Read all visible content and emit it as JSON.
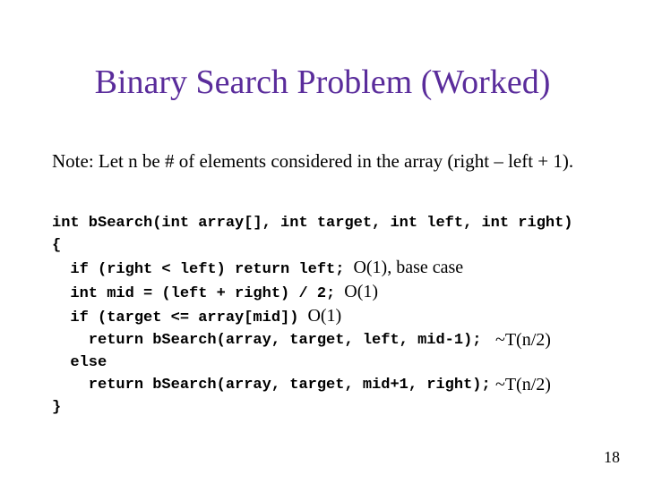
{
  "title": "Binary Search Problem (Worked)",
  "note": "Note: Let n be # of elements considered in the array (right – left + 1).",
  "code": {
    "l1": "int bSearch(int array[], int target, int left, int right)",
    "l2": "{",
    "l3": "  if (right < left) return left;",
    "l3a": "  O(1), base case",
    "l4": "  int mid = (left + right) / 2;",
    "l4a": "  O(1)",
    "l5": "  if (target <= array[mid])",
    "l5a": "  O(1)",
    "l6": "    return bSearch(array, target, left, mid-1);",
    "l6a": "~T(n/2)",
    "l7": "  else",
    "l8": "    return bSearch(array, target, mid+1, right);",
    "l8a": "~T(n/2)",
    "l9": "}"
  },
  "page": "18"
}
